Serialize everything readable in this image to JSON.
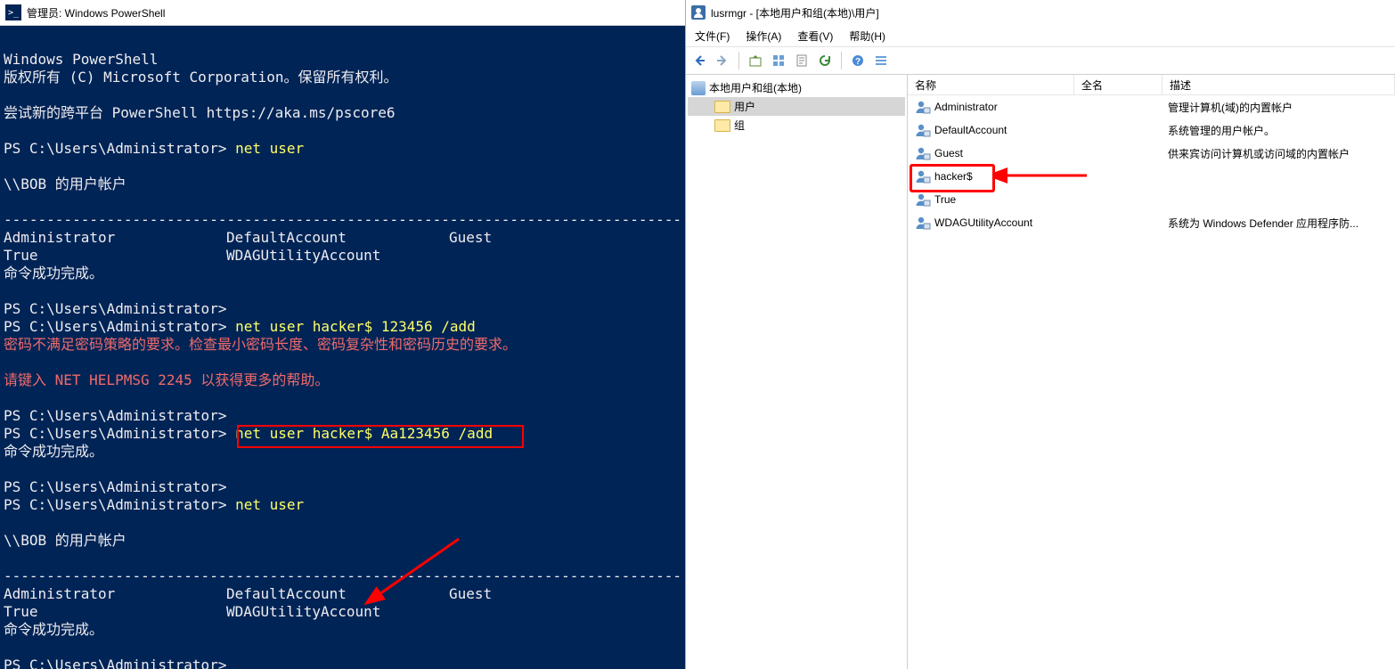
{
  "ps": {
    "title": "管理员: Windows PowerShell",
    "lines": {
      "l1": "Windows PowerShell",
      "l2": "版权所有 (C) Microsoft Corporation。保留所有权利。",
      "l3": "尝试新的跨平台 PowerShell https://aka.ms/pscore6",
      "p1": "PS C:\\Users\\Administrator>",
      "cmd1": "net user",
      "hdr": "\\\\BOB 的用户帐户",
      "sep": "-------------------------------------------------------------------------------",
      "r1a": "Administrator",
      "r1b": "DefaultAccount",
      "r1c": "Guest",
      "r2a": "True",
      "r2b": "WDAGUtilityAccount",
      "done": "命令成功完成。",
      "cmd2": "net user hacker$ 123456 /add",
      "err1": "密码不满足密码策略的要求。检查最小密码长度、密码复杂性和密码历史的要求。",
      "err2": "请键入 NET HELPMSG 2245 以获得更多的帮助。",
      "cmd3": "net user hacker$ Aa123456 /add",
      "cmd4": "net user"
    }
  },
  "lm": {
    "title": "lusrmgr - [本地用户和组(本地)\\用户]",
    "menu": {
      "file": "文件(F)",
      "action": "操作(A)",
      "view": "查看(V)",
      "help": "帮助(H)"
    },
    "tree": {
      "root": "本地用户和组(本地)",
      "users": "用户",
      "groups": "组"
    },
    "columns": {
      "name": "名称",
      "full": "全名",
      "desc": "描述"
    },
    "users": [
      {
        "name": "Administrator",
        "desc": "管理计算机(域)的内置帐户"
      },
      {
        "name": "DefaultAccount",
        "desc": "系统管理的用户帐户。"
      },
      {
        "name": "Guest",
        "desc": "供来宾访问计算机或访问域的内置帐户"
      },
      {
        "name": "hacker$",
        "desc": ""
      },
      {
        "name": "True",
        "desc": ""
      },
      {
        "name": "WDAGUtilityAccount",
        "desc": "系统为 Windows Defender 应用程序防..."
      }
    ]
  }
}
